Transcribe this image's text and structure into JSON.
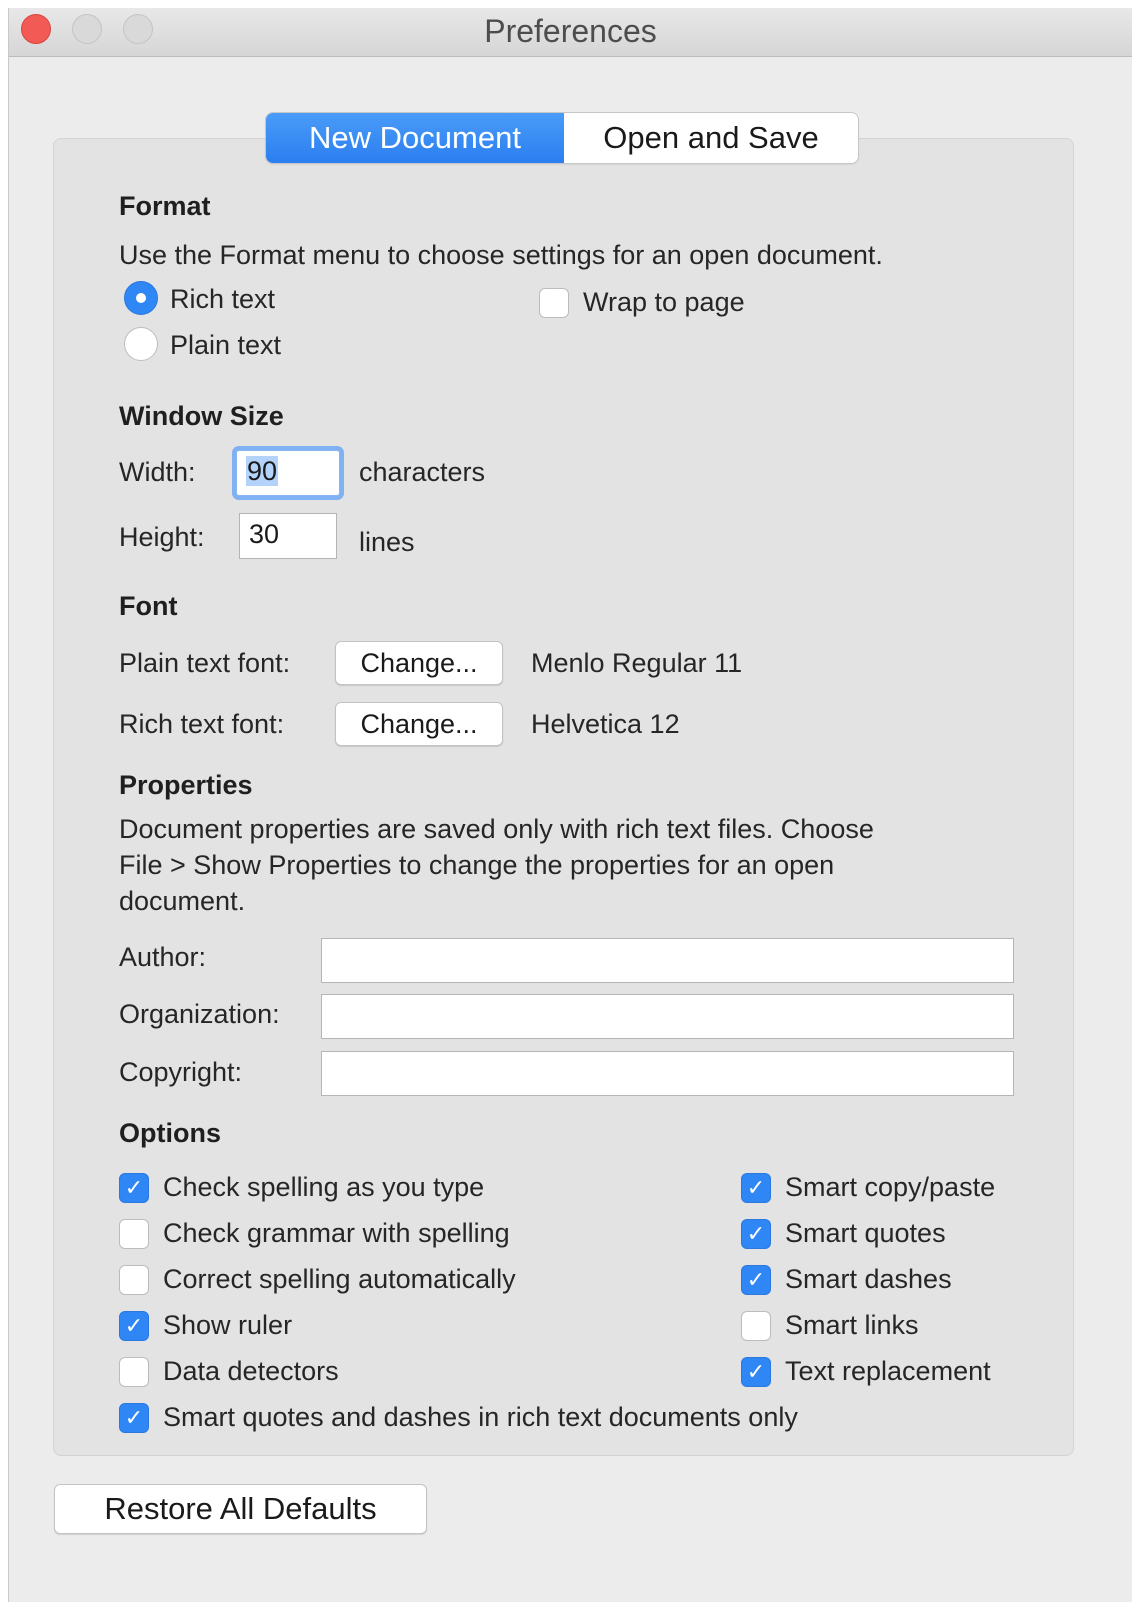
{
  "window": {
    "title": "Preferences"
  },
  "tabs": [
    {
      "label": "New Document",
      "active": true
    },
    {
      "label": "Open and Save",
      "active": false
    }
  ],
  "format": {
    "heading": "Format",
    "description": "Use the Format menu to choose settings for an open document.",
    "rich_text_label": "Rich text",
    "plain_text_label": "Plain text",
    "selected": "Rich text",
    "wrap_label": "Wrap to page",
    "wrap_checked": false
  },
  "window_size": {
    "heading": "Window Size",
    "width_label": "Width:",
    "width_value": "90",
    "width_unit": "characters",
    "height_label": "Height:",
    "height_value": "30",
    "height_unit": "lines"
  },
  "font": {
    "heading": "Font",
    "plain_label": "Plain text font:",
    "plain_button": "Change...",
    "plain_value": "Menlo Regular 11",
    "rich_label": "Rich text font:",
    "rich_button": "Change...",
    "rich_value": "Helvetica 12"
  },
  "properties": {
    "heading": "Properties",
    "desc_line1": "Document properties are saved only with rich text files. Choose",
    "desc_line2": "File > Show Properties to change the properties for an open",
    "desc_line3": "document.",
    "author_label": "Author:",
    "author_value": "",
    "organization_label": "Organization:",
    "organization_value": "",
    "copyright_label": "Copyright:",
    "copyright_value": ""
  },
  "options": {
    "heading": "Options",
    "left": [
      {
        "label": "Check spelling as you type",
        "checked": true
      },
      {
        "label": "Check grammar with spelling",
        "checked": false
      },
      {
        "label": "Correct spelling automatically",
        "checked": false
      },
      {
        "label": "Show ruler",
        "checked": true
      },
      {
        "label": "Data detectors",
        "checked": false
      },
      {
        "label": "Smart quotes and dashes in rich text documents only",
        "checked": true
      }
    ],
    "right": [
      {
        "label": "Smart copy/paste",
        "checked": true
      },
      {
        "label": "Smart quotes",
        "checked": true
      },
      {
        "label": "Smart dashes",
        "checked": true
      },
      {
        "label": "Smart links",
        "checked": false
      },
      {
        "label": "Text replacement",
        "checked": true
      }
    ]
  },
  "footer": {
    "restore_button": "Restore All Defaults"
  },
  "colors": {
    "accent": "#2f86f5",
    "panel": "#e3e3e3",
    "window": "#ececec"
  }
}
